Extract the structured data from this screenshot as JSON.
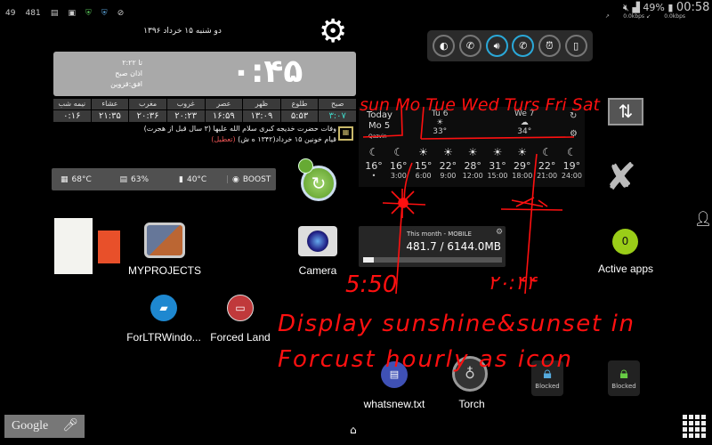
{
  "status_bar": {
    "left_items": [
      "49",
      "481",
      "clipboard",
      "photo",
      "shield-green",
      "shield-blue",
      "compass"
    ],
    "battery": "49%",
    "time": "00:58",
    "speed_up": "0.0kbps",
    "speed_down": "0.0kbps"
  },
  "prayer_widget": {
    "date": "دو شنبه ۱۵ خرداد ۱۳۹۶",
    "countdown": "۰:۴۵",
    "remaining": "۲:۲۲ تا",
    "next_prayer": "اذان صبح",
    "horizon": "افق:قزوین",
    "headers": [
      "نیمه شب",
      "عشاء",
      "مغرب",
      "غروب",
      "عصر",
      "ظهر",
      "طلوع",
      "صبح"
    ],
    "times": [
      "۰:۱۶",
      "۲۱:۳۵",
      "۲۰:۳۶",
      "۲۰:۲۳",
      "۱۶:۵۹",
      "۱۳:۰۹",
      "۵:۵۳",
      "۳:۰۷"
    ],
    "events": [
      "وفات حضرت خدیجه کبری سلام الله علیها (۳ سال قبل از هجرت)",
      "قیام خونین ۱۵ خرداد(۱۳۴۲ ه ش)"
    ],
    "holiday": "(تعطیل)",
    "accent": "#3fd8c8"
  },
  "toggles": [
    "brightness",
    "call-block",
    "volume",
    "phone",
    "alarm",
    "screen"
  ],
  "weather": {
    "today": "Today",
    "today_day": "Mo 5",
    "city": "Qazvin",
    "days": [
      {
        "label": "Tu 6",
        "temp": "33°"
      },
      {
        "label": "We 7",
        "temp": "34°"
      }
    ],
    "hourly": [
      {
        "t": "16°",
        "h": "•",
        "i": "moon"
      },
      {
        "t": "16°",
        "h": "3:00",
        "i": "moon"
      },
      {
        "t": "15°",
        "h": "6:00",
        "i": "sun-cloud"
      },
      {
        "t": "22°",
        "h": "9:00",
        "i": "sun"
      },
      {
        "t": "28°",
        "h": "12:00",
        "i": "sun"
      },
      {
        "t": "31°",
        "h": "15:00",
        "i": "sun-cloud"
      },
      {
        "t": "29°",
        "h": "18:00",
        "i": "sun-cloud"
      },
      {
        "t": "22°",
        "h": "21:00",
        "i": "moon"
      },
      {
        "t": "19°",
        "h": "24:00",
        "i": "moon-cloud"
      }
    ]
  },
  "sysmon": {
    "cpu": "68°C",
    "ram": "63%",
    "battery": "40°C",
    "boost": "BOOST"
  },
  "data_usage": {
    "title": "This month - MOBILE",
    "value": "481.7 / 6144.0MB",
    "fraction": 0.078
  },
  "active_apps": {
    "count": "0",
    "label": "Active apps",
    "color": "#9acd18"
  },
  "apps": {
    "myprojects": "MYPROJECTS",
    "camera": "Camera",
    "forltr": "ForLTRWindo...",
    "forced": "Forced Land",
    "whatsnew": "whatsnew.txt",
    "torch": "Torch",
    "blocked1": "Blocked",
    "blocked2": "Blocked"
  },
  "search": {
    "label": "Google"
  },
  "annotations": {
    "days": "sun Mo Tue Wed Turs Fri Sat",
    "sunrise": "5:50",
    "sunset": "۲۰:۴۴",
    "line1": "Display sunshine&sunset in",
    "line2": "Forcust hourly as icon",
    "color": "#ff1010"
  }
}
